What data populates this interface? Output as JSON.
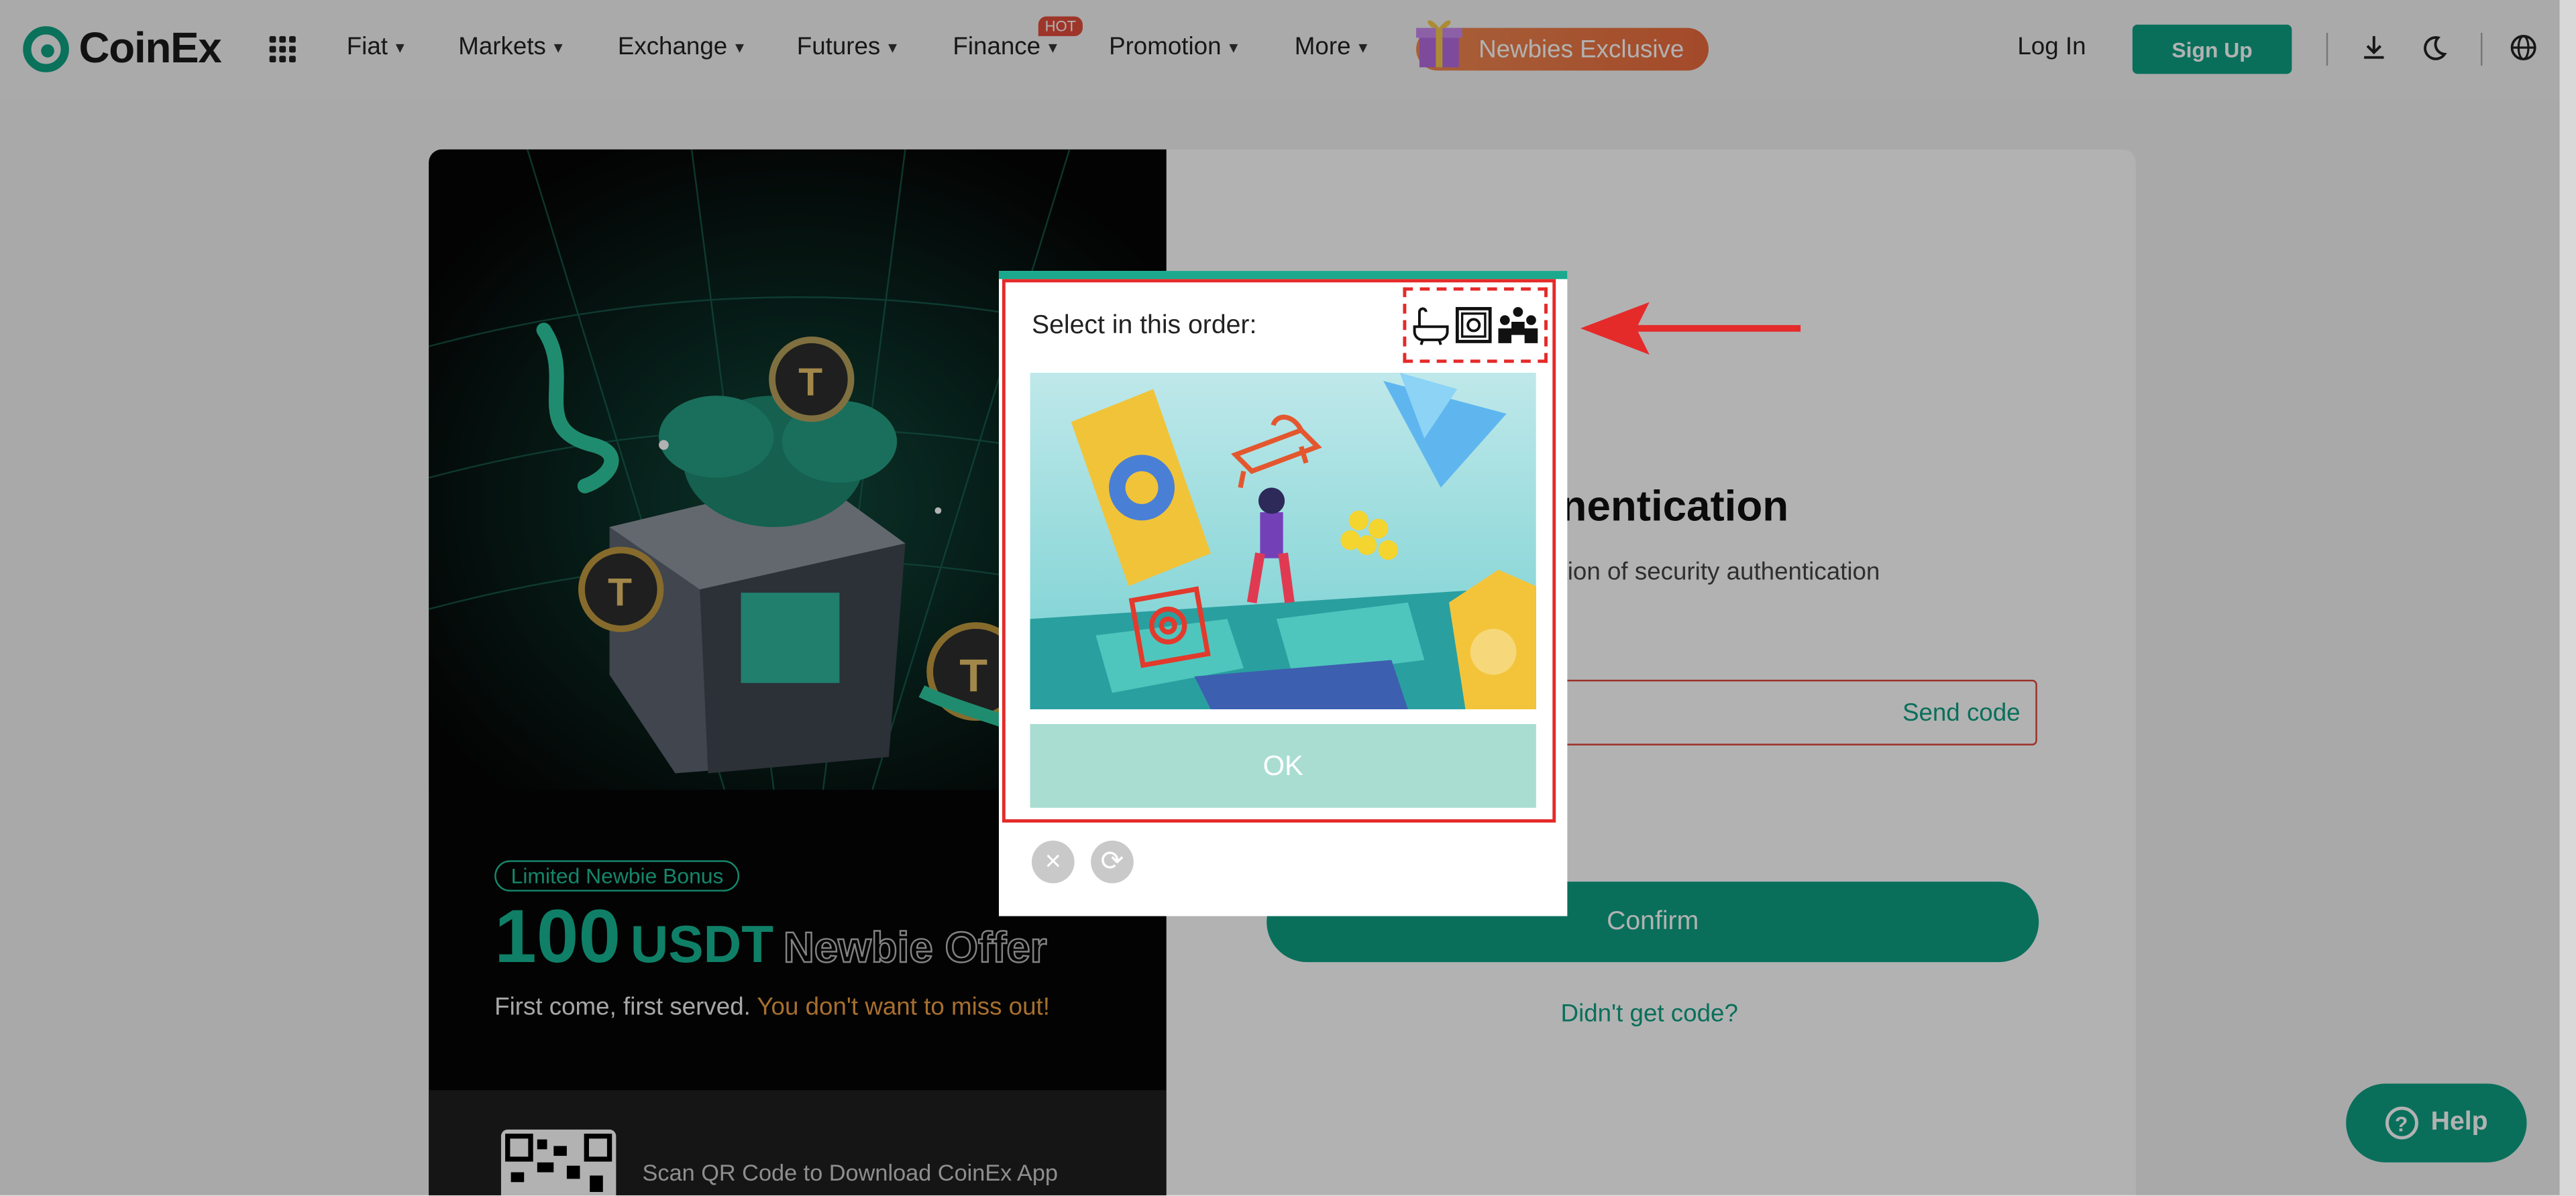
{
  "header": {
    "brand": "CoinEx",
    "nav": [
      "Fiat",
      "Markets",
      "Exchange",
      "Futures",
      "Finance",
      "Promotion",
      "More"
    ],
    "finance_badge": "HOT",
    "promo_label": "Newbies Exclusive",
    "login_label": "Log In",
    "signup_label": "Sign Up"
  },
  "promo_card": {
    "badge": "Limited Newbie Bonus",
    "amount": "100",
    "currency": "USDT",
    "offer": "Newbie Offer",
    "tagline": "First come, first served.",
    "tagline_highlight": "You don't want to miss out!",
    "qr_text": "Scan QR Code to Download CoinEx App"
  },
  "form": {
    "title": "nentication",
    "subtitle": "tion of security authentication",
    "send_code": "Send code",
    "confirm": "Confirm",
    "didnt_get": "Didn't get code?"
  },
  "captcha": {
    "prompt": "Select in this order:",
    "targets": [
      "bathtub-icon",
      "safe-icon",
      "people-group-icon"
    ],
    "ok_label": "OK",
    "close_symbol": "×",
    "refresh_symbol": "⟳"
  },
  "help": {
    "label": "Help"
  },
  "colors": {
    "brand": "#0ea083",
    "hot": "#e24c3c",
    "annotation": "#e52a2a"
  }
}
